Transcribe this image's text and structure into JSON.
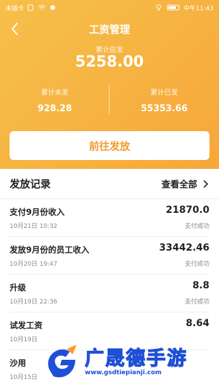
{
  "status_bar": {
    "carrier": "未插卡",
    "time": "中午11:43"
  },
  "nav": {
    "title": "工资管理"
  },
  "summary": {
    "label": "累计应发",
    "value": "5258.00",
    "unpaid_label": "累计未发",
    "unpaid_value": "928.28",
    "paid_label": "累计已发",
    "paid_value": "55353.66"
  },
  "cta_label": "前往发放",
  "records": {
    "title": "发放记录",
    "view_all": "查看全部",
    "items": [
      {
        "name": "支付9月份收入",
        "date": "10月21日 10:32",
        "amount": "21870.0",
        "status": "支付成功"
      },
      {
        "name": "发放9月份的员工收入",
        "date": "10月20日 19:47",
        "amount": "33442.46",
        "status": "支付成功"
      },
      {
        "name": "升级",
        "date": "10月19日 22:36",
        "amount": "8.8",
        "status": "支付成功"
      },
      {
        "name": "试发工资",
        "date": "10月19日",
        "amount": "8.64",
        "status": ""
      },
      {
        "name": "沙用",
        "date": "10月15日",
        "amount": "",
        "status": ""
      }
    ]
  },
  "watermark": {
    "brand": "广晟德手游",
    "url": "www.gsdtiepianji.com"
  },
  "colors": {
    "header_start": "#f6c04a",
    "header_end": "#f7a63a",
    "accent": "#f29a2e",
    "watermark_blue": "#1f4fd6"
  },
  "icons": [
    "back-arrow-icon",
    "chevron-right-icon",
    "battery-icon",
    "location-icon",
    "wifi-icon"
  ]
}
